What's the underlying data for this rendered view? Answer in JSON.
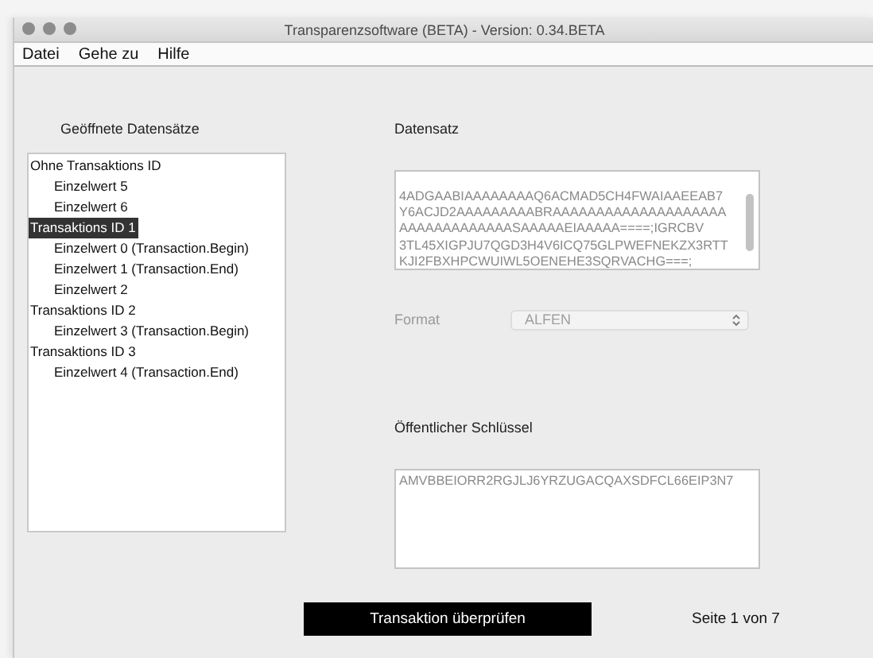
{
  "window": {
    "title": "Transparenzsoftware (BETA) - Version: 0.34.BETA"
  },
  "menu": [
    "Datei",
    "Gehe zu",
    "Hilfe"
  ],
  "datasets": {
    "heading": "Geöffnete Datensätze",
    "tree": [
      {
        "label": "Ohne Transaktions ID",
        "selected": false,
        "children": [
          {
            "label": "Einzelwert 5",
            "selected": false
          },
          {
            "label": "Einzelwert 6",
            "selected": false
          }
        ]
      },
      {
        "label": "Transaktions ID 1",
        "selected": true,
        "children": [
          {
            "label": "Einzelwert 0 (Transaction.Begin)",
            "selected": false
          },
          {
            "label": "Einzelwert 1 (Transaction.End)",
            "selected": false
          },
          {
            "label": "Einzelwert 2",
            "selected": false
          }
        ]
      },
      {
        "label": "Transaktions ID 2",
        "selected": false,
        "children": [
          {
            "label": "Einzelwert 3 (Transaction.Begin)",
            "selected": false
          }
        ]
      },
      {
        "label": "Transaktions ID 3",
        "selected": false,
        "children": [
          {
            "label": "Einzelwert 4 (Transaction.End)",
            "selected": false
          }
        ]
      }
    ]
  },
  "record": {
    "heading": "Datensatz",
    "lines": [
      "4ADGAABIAAAAAAAAQ6ACMAD5CH4FWAIAAEEAB7",
      "Y6ACJD2AAAAAAAAABRAAAAAAAAAAAAAAAAAAAA",
      "AAAAAAAAAAAAASAAAAAEIAAAAA====;IGRCBV",
      "3TL45XIGPJU7QGD3H4V6ICQ75GLPWEFNEKZX3RTT",
      "KJI2FBXHPCWUIWL5OENEHE3SQRVACHG===;"
    ]
  },
  "format": {
    "label": "Format",
    "value": "ALFEN",
    "disabled": true
  },
  "public_key": {
    "heading": "Öffentlicher Schlüssel",
    "value": "AMVBBEIORR2RGJLJ6YRZUGACQAXSDFCL66EIP3N7"
  },
  "verify_button": "Transaktion überprüfen",
  "page_indicator": "Seite 1 von 7"
}
